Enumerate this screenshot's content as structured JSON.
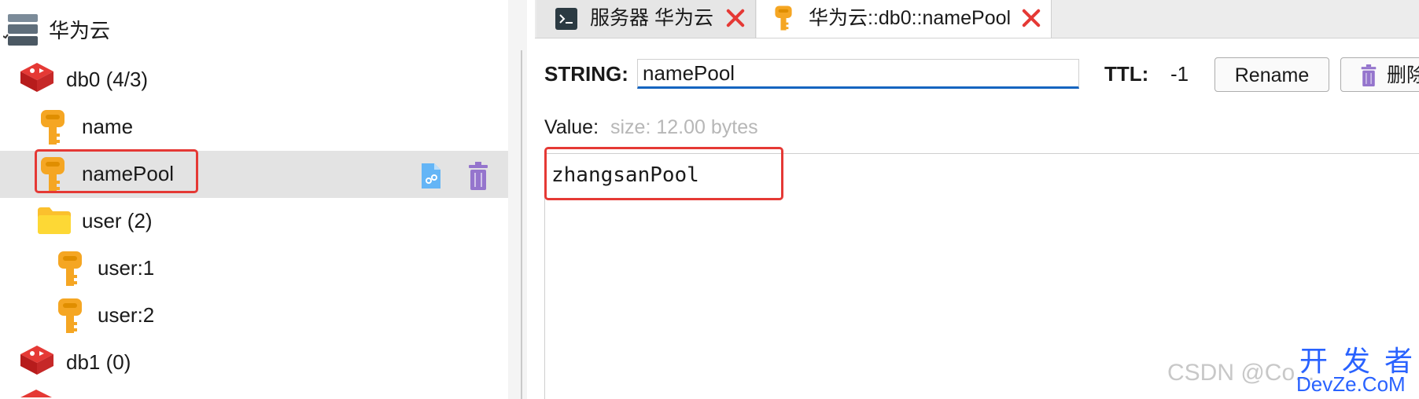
{
  "tree": {
    "root": {
      "label": "华为云"
    },
    "db0": {
      "label": "db0  (4/3)"
    },
    "key_name": {
      "label": "name"
    },
    "key_namepool": {
      "label": "namePool"
    },
    "folder_user": {
      "label": "user (2)"
    },
    "key_user1": {
      "label": "user:1"
    },
    "key_user2": {
      "label": "user:2"
    },
    "db1": {
      "label": "db1 (0)"
    }
  },
  "tabs": [
    {
      "label": "服务器 华为云"
    },
    {
      "label": "华为云::db0::namePool"
    }
  ],
  "editor": {
    "type_label": "STRING:",
    "key_value": "namePool",
    "ttl_label": "TTL:",
    "ttl_value": "-1",
    "rename_label": "Rename",
    "delete_label": "删除",
    "value_label": "Value:",
    "size_text": "size: 12.00 bytes",
    "value_text": "zhangsanPool"
  },
  "watermark": {
    "csdn": "CSDN @Co...",
    "brand_top": "开 发 者",
    "brand_bottom": "DevZe.CoM"
  },
  "colors": {
    "accent": "#1565c0",
    "highlight_box": "#e53935",
    "key_icon": "#f5a623",
    "redis_icon": "#d32f2f",
    "trash_icon": "#9575cd"
  }
}
